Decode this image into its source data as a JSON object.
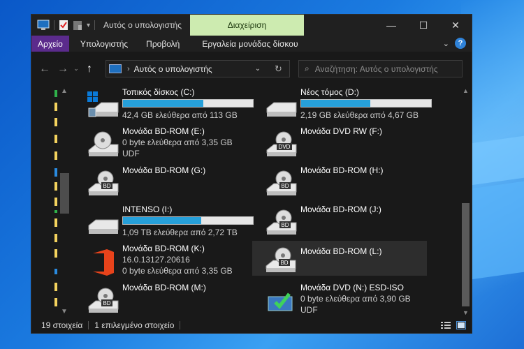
{
  "window": {
    "title": "Αυτός ο υπολογιστής",
    "manage_tab": "Διαχείριση",
    "controls": {
      "minimize": "—",
      "maximize": "☐",
      "close": "✕"
    }
  },
  "ribbon": {
    "tabs": [
      "Αρχείο",
      "Υπολογιστής",
      "Προβολή",
      "Εργαλεία μονάδας δίσκου"
    ],
    "help": "?"
  },
  "address": {
    "path": "Αυτός ο υπολογιστής",
    "search_placeholder": "Αναζήτηση: Αυτός ο υπολογιστής"
  },
  "drives": [
    {
      "name": "Τοπικός δίσκος (C:)",
      "free_text": "42,4 GB ελεύθερα από 113 GB",
      "used_fraction": 0.62,
      "icon": "windows-drive-icon"
    },
    {
      "name": "Νέος τόμος (D:)",
      "free_text": "2,19 GB ελεύθερα από 4,67 GB",
      "used_fraction": 0.53,
      "icon": "hdd-icon"
    },
    {
      "name": "Μονάδα BD-ROM (E:)",
      "free_text": "0 byte ελεύθερα από 3,35 GB",
      "fs": "UDF",
      "icon": "bd-disc-icon"
    },
    {
      "name": "Μονάδα DVD RW (F:)",
      "icon": "dvd-drive-icon",
      "label": "DVD"
    },
    {
      "name": "Μονάδα BD-ROM (G:)",
      "icon": "bd-drive-icon",
      "label": "BD"
    },
    {
      "name": "Μονάδα BD-ROM (H:)",
      "icon": "bd-drive-icon",
      "label": "BD"
    },
    {
      "name": "INTENSO (I:)",
      "free_text": "1,09 TB ελεύθερα από 2,72 TB",
      "used_fraction": 0.6,
      "icon": "hdd-icon"
    },
    {
      "name": "Μονάδα BD-ROM (J:)",
      "icon": "bd-drive-icon",
      "label": "BD"
    },
    {
      "name": "Μονάδα BD-ROM (K:)",
      "sub": "16.0.13127.20616",
      "free_text": "0 byte ελεύθερα από 3,35 GB",
      "icon": "office-icon"
    },
    {
      "name": "Μονάδα BD-ROM (L:)",
      "icon": "bd-drive-icon",
      "label": "BD",
      "selected": true
    },
    {
      "name": "Μονάδα BD-ROM (M:)",
      "icon": "bd-drive-icon",
      "label": "BD"
    },
    {
      "name": "Μονάδα DVD (N:) ESD-ISO",
      "free_text": "0 byte ελεύθερα από 3,90 GB",
      "fs": "UDF",
      "icon": "setup-icon"
    }
  ],
  "status": {
    "count": "19 στοιχεία",
    "selected": "1 επιλεγμένο στοιχείο"
  },
  "colors": {
    "accent": "#26a0da",
    "file_tab": "#5b2b8c",
    "manage_tab": "#cdebb0"
  }
}
